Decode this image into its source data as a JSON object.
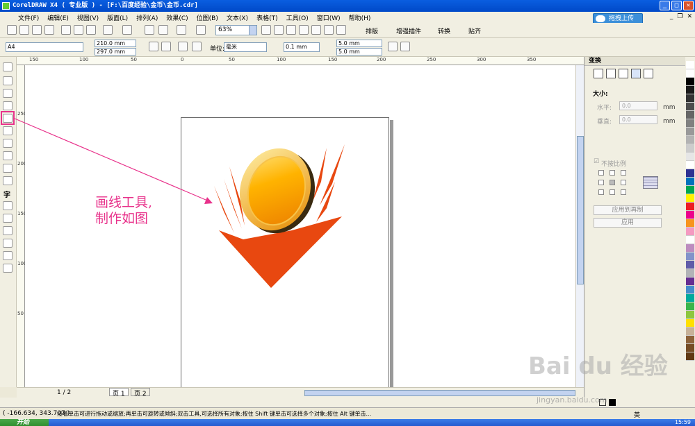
{
  "window": {
    "title": "CorelDRAW X4 ( 专业版 ) - [F:\\百度经验\\金币\\金币.cdr]",
    "controls": [
      "_",
      "□",
      "✕"
    ],
    "mdi_controls": [
      "_",
      "❐",
      "✕"
    ]
  },
  "menu": {
    "items": [
      "文件(F)",
      "编辑(E)",
      "视图(V)",
      "版面(L)",
      "排列(A)",
      "效果(C)",
      "位图(B)",
      "文本(X)",
      "表格(T)",
      "工具(O)",
      "窗口(W)",
      "帮助(H)"
    ]
  },
  "upload": {
    "label": "拖拽上传"
  },
  "toolbar": {
    "zoom": "63%",
    "plugins": [
      "排版",
      "增强插件",
      "转换",
      "贴齐"
    ]
  },
  "propbar": {
    "paper": "A4",
    "width": "210.0 mm",
    "height": "297.0 mm",
    "unit_label": "单位:",
    "unit": "毫米",
    "nudge": "0.1 mm",
    "dup_x": "5.0 mm",
    "dup_y": "5.0 mm"
  },
  "ruler": {
    "top_ticks": [
      "150",
      "100",
      "50",
      "0",
      "50",
      "100",
      "150",
      "200",
      "250",
      "300",
      "350"
    ],
    "left_ticks": [
      "250",
      "200",
      "150",
      "100",
      "50"
    ]
  },
  "annotation": {
    "line1": "画线工具,",
    "line2": "制作如图"
  },
  "pages": {
    "counter": "1 / 2",
    "tabs": [
      "页 1",
      "页 2"
    ]
  },
  "docker": {
    "title": "变换",
    "size_label": "大小:",
    "h_label": "水平:",
    "v_label": "垂直:",
    "h_value": "0.0",
    "v_value": "0.0",
    "unit": "mm",
    "nonprop_label": "不按比例",
    "apply_dup": "应用到再制",
    "apply": "应用"
  },
  "status": {
    "coords": "( -166.634, 343.707 )",
    "hint": "接着单击可进行拖动或缩放;再单击可旋转或倾斜;双击工具,可选择所有对象;按住 Shift 键单击可选择多个对象;按住 Alt 键单击...",
    "start": "开始",
    "clock": "15:59",
    "ime": "英"
  },
  "watermark": {
    "brand": "Bai du 经验",
    "url": "jingyan.baidu.com"
  },
  "colors": {
    "accent": "#e8328b",
    "coin_light": "#ffcc33",
    "coin_dark": "#f08a00",
    "flame": "#e84810",
    "palette": [
      "#ffffff",
      "#000000",
      "#e0e0e0",
      "#c0c0c0",
      "#a0a0a0",
      "#808080",
      "#606060",
      "#404040",
      "#ffffff",
      "#2e3192",
      "#0072bc",
      "#00a651",
      "#fff200",
      "#ed1c24",
      "#ec008c",
      "#f7941d",
      "#f49ac1",
      "#ffffff",
      "#bd8cbf",
      "#8393ca",
      "#605ca8",
      "#b2b3b7",
      "#662d91",
      "#448ccb",
      "#00a99d",
      "#39b54a",
      "#8dc63f"
    ]
  }
}
